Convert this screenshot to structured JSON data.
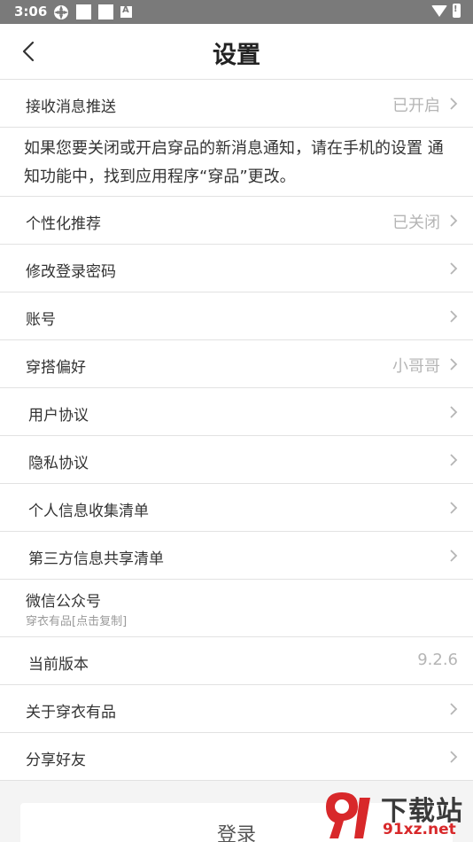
{
  "status_bar": {
    "time": "3:06",
    "notif_label": "A",
    "battery_label": "!"
  },
  "header": {
    "title": "设置"
  },
  "rows": {
    "push": {
      "label": "接收消息推送",
      "value": "已开启"
    },
    "notice": "如果您要关闭或开启穿品的新消息通知，请在手机的设置 通知功能中，找到应用程序“穿品”更改。",
    "personalized": {
      "label": "个性化推荐",
      "value": "已关闭"
    },
    "password": {
      "label": "修改登录密码"
    },
    "account": {
      "label": "账号"
    },
    "style_pref": {
      "label": "穿搭偏好",
      "value": "小哥哥"
    },
    "user_agreement": {
      "label": "用户协议"
    },
    "privacy": {
      "label": "隐私协议"
    },
    "info_list": {
      "label": "个人信息收集清单"
    },
    "third_party": {
      "label": "第三方信息共享清单"
    },
    "wechat": {
      "label": "微信公众号",
      "sub": "穿衣有品[点击复制]"
    },
    "version": {
      "label": "当前版本",
      "value": "9.2.6"
    },
    "about": {
      "label": "关于穿衣有品"
    },
    "share": {
      "label": "分享好友"
    }
  },
  "login_button": "登录",
  "watermark": {
    "logo_text": "9",
    "text1": "下载站",
    "text2": "91xz.net"
  }
}
